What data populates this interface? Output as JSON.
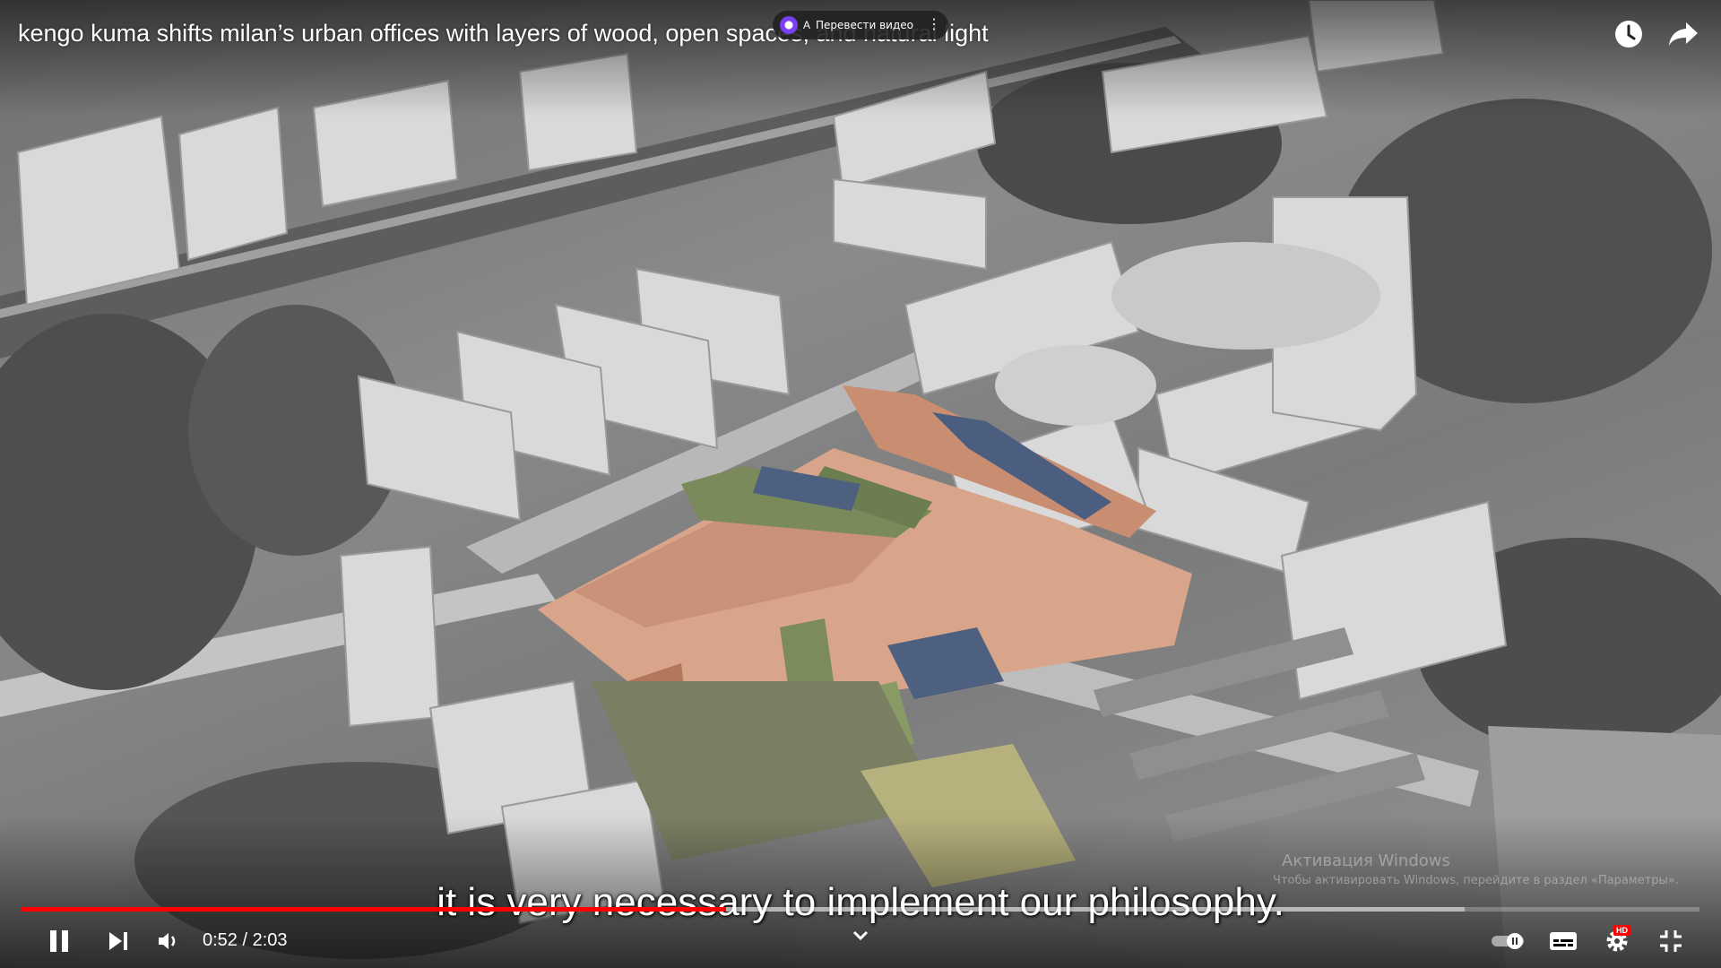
{
  "player": {
    "title": "kengo kuma shifts milan’s urban offices with layers of wood, open spaces, and natural light",
    "translate_button": {
      "prefix": "A",
      "label": "Перевести видео"
    },
    "caption": "it is very necessary to implement our philosophy.",
    "watermark": "Активация Windows",
    "watermark_sub": "Чтобы активировать Windows, перейдите в раздел «Параметры».",
    "current_time": "0:52",
    "duration": "2:03",
    "time_text": "0:52 / 2:03",
    "played_fraction": 0.42,
    "buffered_fraction": 0.86,
    "hd_badge": "HD",
    "icons": {
      "alice": "alice-icon",
      "more": "kebab-icon",
      "watch_later": "clock-icon",
      "share": "share-icon",
      "pause": "pause-icon",
      "next": "next-icon",
      "volume": "volume-icon",
      "expand": "chevron-down-icon",
      "autoplay": "autoplay-toggle-icon",
      "subtitles": "subtitles-icon",
      "settings": "gear-icon",
      "fullscreen_exit": "fullscreen-exit-icon"
    },
    "colors": {
      "progress": "#ff0000",
      "accent_purple": "#7b3ff2"
    }
  }
}
